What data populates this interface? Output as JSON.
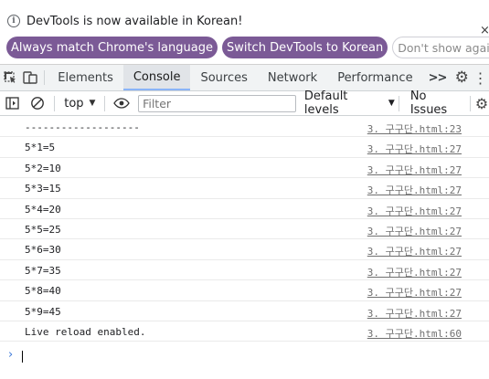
{
  "infobar": {
    "message": "DevTools is now available in Korean!",
    "buttons": {
      "match_language": "Always match Chrome's language",
      "switch_korean": "Switch DevTools to Korean",
      "dont_show": "Don't show again"
    },
    "close_glyph": "×"
  },
  "tabs": {
    "elements": "Elements",
    "console": "Console",
    "sources": "Sources",
    "network": "Network",
    "performance": "Performance",
    "more_glyph": ">>"
  },
  "console_toolbar": {
    "context": "top",
    "filter_placeholder": "Filter",
    "levels": "Default levels",
    "issues": "No Issues"
  },
  "messages": [
    {
      "text": "-------------------",
      "source": "3. 구구단.html:23"
    },
    {
      "text": "5*1=5",
      "source": "3. 구구단.html:27"
    },
    {
      "text": "5*2=10",
      "source": "3. 구구단.html:27"
    },
    {
      "text": "5*3=15",
      "source": "3. 구구단.html:27"
    },
    {
      "text": "5*4=20",
      "source": "3. 구구단.html:27"
    },
    {
      "text": "5*5=25",
      "source": "3. 구구단.html:27"
    },
    {
      "text": "5*6=30",
      "source": "3. 구구단.html:27"
    },
    {
      "text": "5*7=35",
      "source": "3. 구구단.html:27"
    },
    {
      "text": "5*8=40",
      "source": "3. 구구단.html:27"
    },
    {
      "text": "5*9=45",
      "source": "3. 구구단.html:27"
    },
    {
      "text": "Live reload enabled.",
      "source": "3. 구구단.html:60"
    }
  ],
  "prompt_glyph": "›",
  "colors": {
    "pill_bg": "#7b5a96",
    "active_tab_underline": "#8ab4f8",
    "prompt": "#3c78d8"
  }
}
